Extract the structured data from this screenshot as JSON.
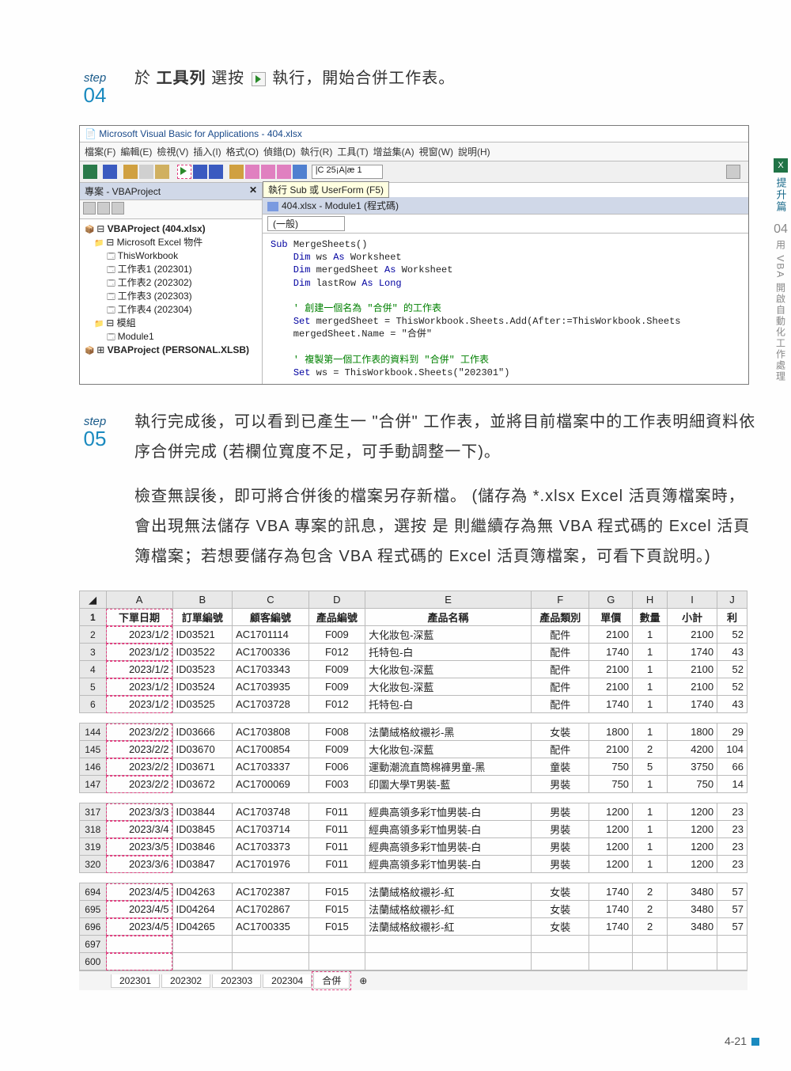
{
  "side": {
    "excel_label": "X",
    "section": "提升篇",
    "chapter_num": "04",
    "chapter_text": "用 VBA 開啟自動化工作處理"
  },
  "page_number": "4-21",
  "step4": {
    "label": "step",
    "num": "04",
    "text_prefix": "於 ",
    "toolbar": "工具列",
    "text_mid": " 選按 ",
    "text_suffix": " 執行，開始合併工作表。"
  },
  "vba": {
    "title": "Microsoft Visual Basic for Applications - 404.xlsx",
    "menu": [
      "檔案(F)",
      "編輯(E)",
      "檢視(V)",
      "插入(I)",
      "格式(O)",
      "偵錯(D)",
      "執行(R)",
      "工具(T)",
      "增益集(A)",
      "視窗(W)",
      "說明(H)"
    ],
    "toolbar_value": "|C 25¡A|æ 1",
    "panel_title": "專案 - VBAProject",
    "tooltip": "執行 Sub 或 UserForm (F5)",
    "module_caption": "404.xlsx - Module1 (程式碼)",
    "dropdown": "(一般)",
    "tree": {
      "root": "VBAProject (404.xlsx)",
      "objects": "Microsoft Excel 物件",
      "items": [
        "ThisWorkbook",
        "工作表1 (202301)",
        "工作表2 (202302)",
        "工作表3 (202303)",
        "工作表4 (202304)"
      ],
      "modules_folder": "模組",
      "module": "Module1",
      "personal": "VBAProject (PERSONAL.XLSB)"
    },
    "code": [
      {
        "t": "kw",
        "v": "Sub "
      },
      {
        "t": "",
        "v": "MergeSheets()"
      },
      "\n",
      {
        "t": "kw",
        "v": "    Dim "
      },
      {
        "t": "",
        "v": "ws "
      },
      {
        "t": "kw",
        "v": "As"
      },
      {
        "t": "",
        "v": " Worksheet"
      },
      "\n",
      {
        "t": "kw",
        "v": "    Dim "
      },
      {
        "t": "",
        "v": "mergedSheet "
      },
      {
        "t": "kw",
        "v": "As"
      },
      {
        "t": "",
        "v": " Worksheet"
      },
      "\n",
      {
        "t": "kw",
        "v": "    Dim "
      },
      {
        "t": "",
        "v": "lastRow "
      },
      {
        "t": "kw",
        "v": "As Long"
      },
      "\n",
      "\n",
      {
        "t": "comment",
        "v": "    ' 創建一個名為 \"合併\" 的工作表"
      },
      "\n",
      {
        "t": "",
        "v": "    "
      },
      {
        "t": "kw",
        "v": "Set"
      },
      {
        "t": "",
        "v": " mergedSheet = ThisWorkbook.Sheets.Add(After:=ThisWorkbook.Sheets"
      },
      "\n",
      {
        "t": "",
        "v": "    mergedSheet.Name = "
      },
      {
        "t": "",
        "v": "\"合併\""
      },
      "\n",
      "\n",
      {
        "t": "comment",
        "v": "    ' 複製第一個工作表的資料到 \"合併\" 工作表"
      },
      "\n",
      {
        "t": "",
        "v": "    "
      },
      {
        "t": "kw",
        "v": "Set"
      },
      {
        "t": "",
        "v": " ws = ThisWorkbook.Sheets(\"202301\")"
      }
    ]
  },
  "step5": {
    "label": "step",
    "num": "05",
    "p1": "執行完成後，可以看到已產生一 \"合併\" 工作表，並將目前檔案中的工作表明細資料依序合併完成 (若欄位寬度不足，可手動調整一下)。",
    "p2": "檢查無誤後，即可將合併後的檔案另存新檔。 (儲存為 *.xlsx Excel 活頁簿檔案時，會出現無法儲存 VBA 專案的訊息，選按 是 則繼續存為無 VBA 程式碼的 Excel 活頁簿檔案；若想要儲存為包含 VBA 程式碼的 Excel 活頁簿檔案，可看下頁說明。)"
  },
  "sheet": {
    "col_letters": [
      "A",
      "B",
      "C",
      "D",
      "E",
      "F",
      "G",
      "H",
      "I",
      "J"
    ],
    "headers": [
      "下單日期",
      "訂單編號",
      "顧客編號",
      "產品編號",
      "產品名稱",
      "產品類別",
      "單價",
      "數量",
      "小計",
      "利"
    ],
    "groups": [
      {
        "rows": [
          {
            "r": "1"
          },
          {
            "r": "2",
            "c": [
              "2023/1/2",
              "ID03521",
              "AC1701114",
              "F009",
              "大化妝包-深藍",
              "配件",
              "2100",
              "1",
              "2100",
              "52"
            ]
          },
          {
            "r": "3",
            "c": [
              "2023/1/2",
              "ID03522",
              "AC1700336",
              "F012",
              "托特包-白",
              "配件",
              "1740",
              "1",
              "1740",
              "43"
            ]
          },
          {
            "r": "4",
            "c": [
              "2023/1/2",
              "ID03523",
              "AC1703343",
              "F009",
              "大化妝包-深藍",
              "配件",
              "2100",
              "1",
              "2100",
              "52"
            ]
          },
          {
            "r": "5",
            "c": [
              "2023/1/2",
              "ID03524",
              "AC1703935",
              "F009",
              "大化妝包-深藍",
              "配件",
              "2100",
              "1",
              "2100",
              "52"
            ]
          },
          {
            "r": "6",
            "c": [
              "2023/1/2",
              "ID03525",
              "AC1703728",
              "F012",
              "托特包-白",
              "配件",
              "1740",
              "1",
              "1740",
              "43"
            ]
          }
        ]
      },
      {
        "rows": [
          {
            "r": "144",
            "c": [
              "2023/2/2",
              "ID03666",
              "AC1703808",
              "F008",
              "法蘭絨格紋襯衫-黑",
              "女裝",
              "1800",
              "1",
              "1800",
              "29"
            ]
          },
          {
            "r": "145",
            "c": [
              "2023/2/2",
              "ID03670",
              "AC1700854",
              "F009",
              "大化妝包-深藍",
              "配件",
              "2100",
              "2",
              "4200",
              "104"
            ]
          },
          {
            "r": "146",
            "c": [
              "2023/2/2",
              "ID03671",
              "AC1703337",
              "F006",
              "運動潮流直筒棉褲男童-黑",
              "童裝",
              "750",
              "5",
              "3750",
              "66"
            ]
          },
          {
            "r": "147",
            "c": [
              "2023/2/2",
              "ID03672",
              "AC1700069",
              "F003",
              "印圖大學T男裝-藍",
              "男裝",
              "750",
              "1",
              "750",
              "14"
            ]
          }
        ]
      },
      {
        "rows": [
          {
            "r": "317",
            "c": [
              "2023/3/3",
              "ID03844",
              "AC1703748",
              "F011",
              "經典高領多彩T恤男裝-白",
              "男裝",
              "1200",
              "1",
              "1200",
              "23"
            ]
          },
          {
            "r": "318",
            "c": [
              "2023/3/4",
              "ID03845",
              "AC1703714",
              "F011",
              "經典高領多彩T恤男裝-白",
              "男裝",
              "1200",
              "1",
              "1200",
              "23"
            ]
          },
          {
            "r": "319",
            "c": [
              "2023/3/5",
              "ID03846",
              "AC1703373",
              "F011",
              "經典高領多彩T恤男裝-白",
              "男裝",
              "1200",
              "1",
              "1200",
              "23"
            ]
          },
          {
            "r": "320",
            "c": [
              "2023/3/6",
              "ID03847",
              "AC1701976",
              "F011",
              "經典高領多彩T恤男裝-白",
              "男裝",
              "1200",
              "1",
              "1200",
              "23"
            ]
          }
        ]
      },
      {
        "rows": [
          {
            "r": "694",
            "c": [
              "2023/4/5",
              "ID04263",
              "AC1702387",
              "F015",
              "法蘭絨格紋襯衫-紅",
              "女裝",
              "1740",
              "2",
              "3480",
              "57"
            ]
          },
          {
            "r": "695",
            "c": [
              "2023/4/5",
              "ID04264",
              "AC1702867",
              "F015",
              "法蘭絨格紋襯衫-紅",
              "女裝",
              "1740",
              "2",
              "3480",
              "57"
            ]
          },
          {
            "r": "696",
            "c": [
              "2023/4/5",
              "ID04265",
              "AC1700335",
              "F015",
              "法蘭絨格紋襯衫-紅",
              "女裝",
              "1740",
              "2",
              "3480",
              "57"
            ]
          },
          {
            "r": "697",
            "c": [
              "",
              "",
              "",
              "",
              "",
              "",
              "",
              "",
              "",
              ""
            ]
          },
          {
            "r": "600",
            "c": [
              "",
              "",
              "",
              "",
              "",
              "",
              "",
              "",
              "",
              ""
            ]
          }
        ]
      }
    ],
    "tabs": [
      "202301",
      "202302",
      "202303",
      "202304",
      "合併"
    ],
    "add_tab": "⊕"
  }
}
